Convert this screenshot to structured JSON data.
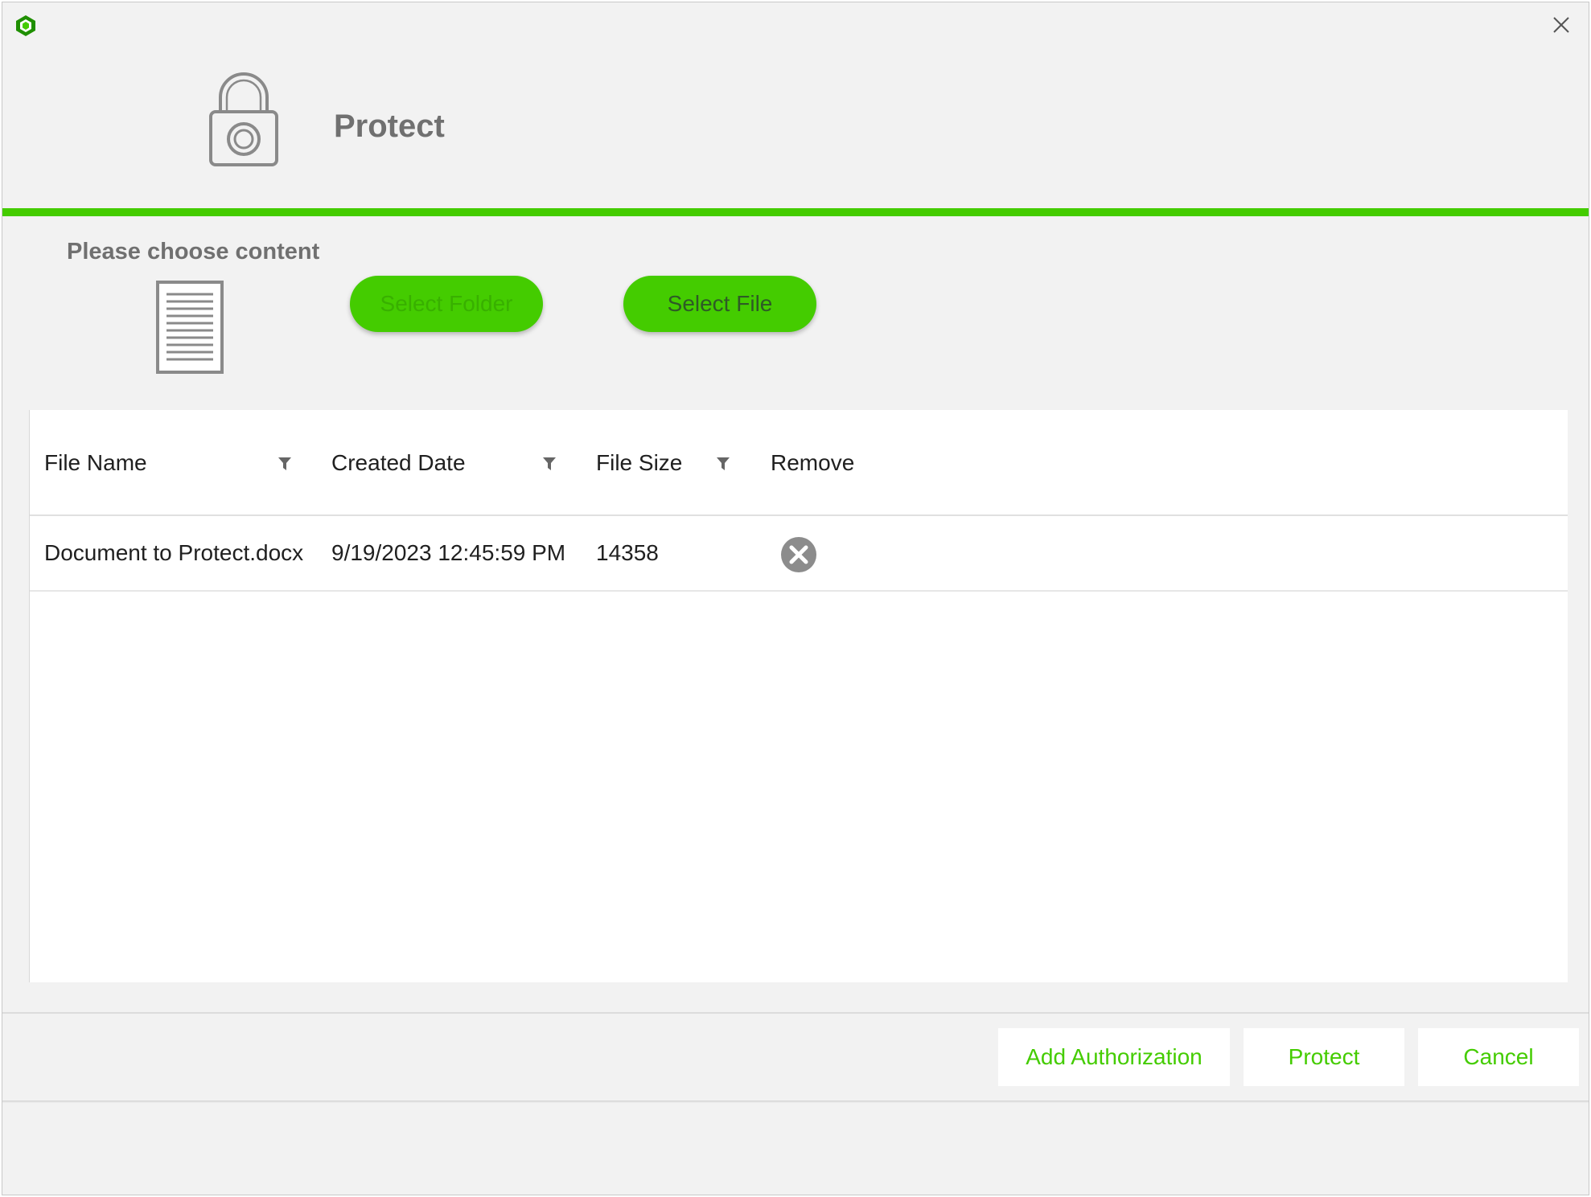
{
  "window": {
    "title": "Protect",
    "close_icon": "close-icon",
    "logo_icon": "app-logo-icon"
  },
  "header": {
    "icon": "lock-icon",
    "title": "Protect"
  },
  "content": {
    "choose_label": "Please choose content",
    "document_icon": "document-icon",
    "select_folder_label": "Select Folder",
    "select_folder_enabled": false,
    "select_file_label": "Select File",
    "select_file_enabled": true
  },
  "table": {
    "columns": [
      {
        "label": "File Name",
        "filterable": true
      },
      {
        "label": "Created Date",
        "filterable": true
      },
      {
        "label": "File Size",
        "filterable": true
      },
      {
        "label": "Remove",
        "filterable": false
      }
    ],
    "rows": [
      {
        "file_name": "Document to Protect.docx",
        "created_date": "9/19/2023 12:45:59 PM",
        "file_size": "14358",
        "remove_icon": "remove-circle-icon"
      }
    ]
  },
  "footer": {
    "add_authorization_label": "Add Authorization",
    "protect_label": "Protect",
    "cancel_label": "Cancel"
  },
  "colors": {
    "accent": "#44cc00",
    "background": "#f2f2f2",
    "title_text": "#707070"
  }
}
